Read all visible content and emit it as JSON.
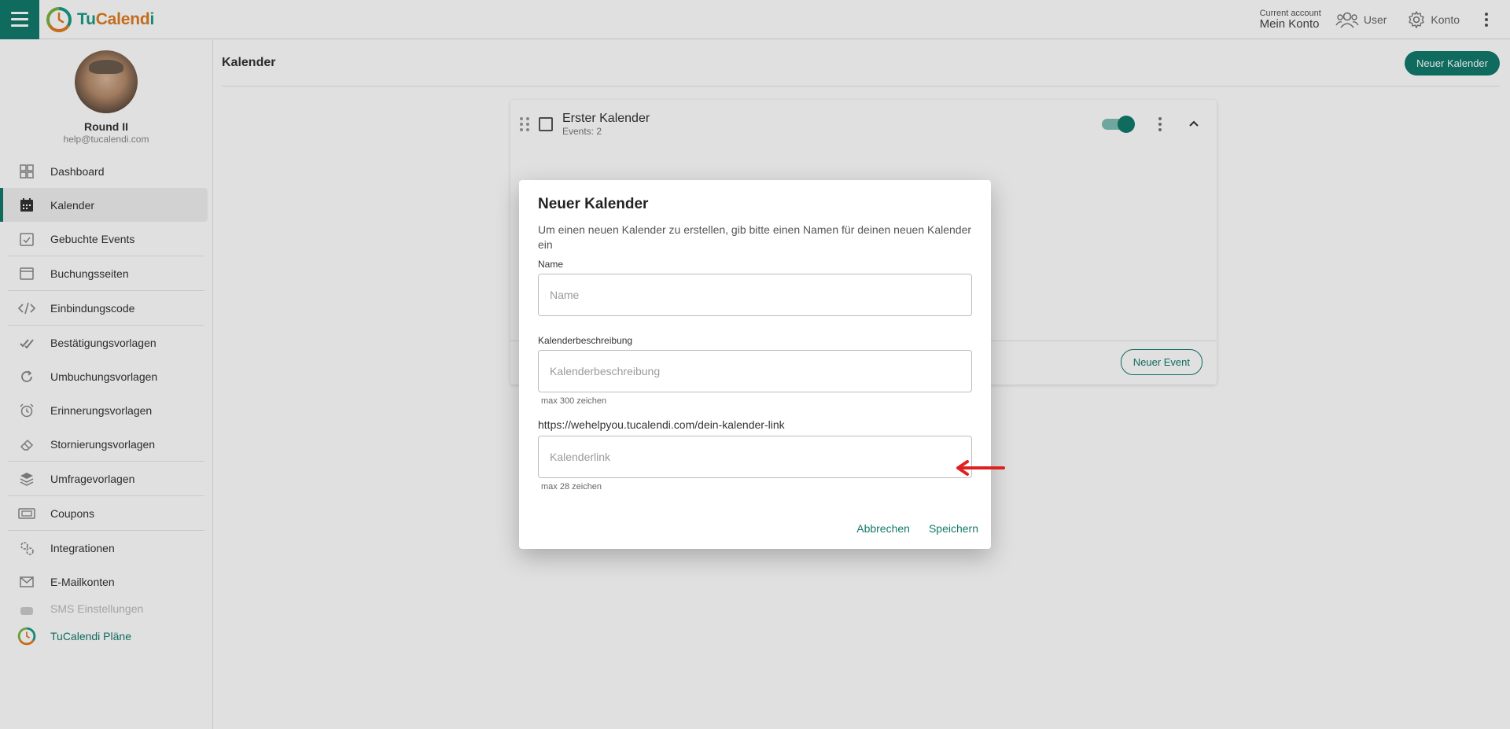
{
  "app": {
    "name_part1": "Tu",
    "name_part2": "Calend",
    "name_part3": "i"
  },
  "topbar": {
    "account_small": "Current account",
    "account_big": "Mein Konto",
    "user_label": "User",
    "konto_label": "Konto"
  },
  "profile": {
    "name": "Round II",
    "email": "help@tucalendi.com"
  },
  "sidebar": {
    "items": [
      {
        "label": "Dashboard"
      },
      {
        "label": "Kalender"
      },
      {
        "label": "Gebuchte Events"
      },
      {
        "label": "Buchungsseiten"
      },
      {
        "label": "Einbindungscode"
      },
      {
        "label": "Bestätigungsvorlagen"
      },
      {
        "label": "Umbuchungsvorlagen"
      },
      {
        "label": "Erinnerungsvorlagen"
      },
      {
        "label": "Stornierungsvorlagen"
      },
      {
        "label": "Umfragevorlagen"
      },
      {
        "label": "Coupons"
      },
      {
        "label": "Integrationen"
      },
      {
        "label": "E-Mailkonten"
      },
      {
        "label": "SMS Einstellungen"
      },
      {
        "label": "TuCalendi Pläne"
      }
    ]
  },
  "main": {
    "title": "Kalender",
    "new_calendar_button": "Neuer Kalender",
    "card": {
      "title": "Erster Kalender",
      "events": "Events: 2",
      "new_event_button": "Neuer Event"
    }
  },
  "dialog": {
    "title": "Neuer Kalender",
    "description": "Um einen neuen Kalender zu erstellen, gib bitte einen Namen für deinen neuen Kalender ein",
    "name_label": "Name",
    "name_placeholder": "Name",
    "desc_label": "Kalenderbeschreibung",
    "desc_placeholder": "Kalenderbeschreibung",
    "desc_hint": "max 300 zeichen",
    "link_label": "https://wehelpyou.tucalendi.com/dein-kalender-link",
    "link_placeholder": "Kalenderlink",
    "link_hint": "max 28 zeichen",
    "cancel": "Abbrechen",
    "save": "Speichern"
  },
  "colors": {
    "brand": "#117a6b",
    "accent_orange": "#e07b1f",
    "annotation_arrow": "#e02020"
  }
}
